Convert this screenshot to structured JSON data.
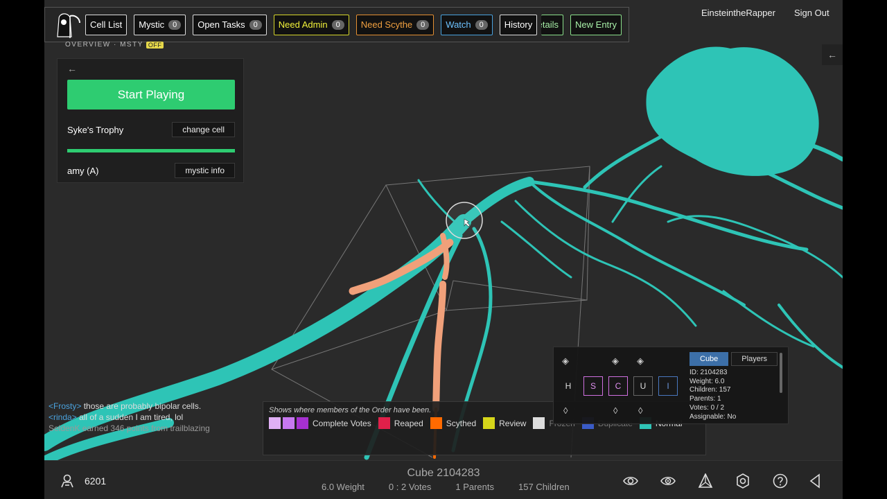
{
  "nav": {
    "buttons": [
      {
        "label": "Cell List"
      },
      {
        "label": "Mystic",
        "count": "0"
      },
      {
        "label": "Open Tasks",
        "count": "0"
      },
      {
        "label": "Need Admin",
        "count": "0"
      },
      {
        "label": "Need Scythe",
        "count": "0"
      },
      {
        "label": "Watch",
        "count": "0"
      },
      {
        "label": "History"
      },
      {
        "label": "be Details"
      },
      {
        "label": "New Entry"
      }
    ],
    "username": "EinsteintheRapper",
    "signout": "Sign Out"
  },
  "overview": {
    "label": "OVERVIEW · MSTY",
    "toggle": "OFF"
  },
  "panel": {
    "back": "←",
    "start": "Start Playing",
    "cell_name": "Syke's Trophy",
    "change_cell": "change cell",
    "player": "amy (A)",
    "mystic_info": "mystic info",
    "progress": 1.0
  },
  "chat": [
    {
      "nick": "Frosty",
      "text": "those are probably bipolar cells."
    },
    {
      "nick": "rinda",
      "text": "all of a sudden I am tired, lol"
    },
    {
      "system": "SeldenK earned 346 points from trailblazing"
    }
  ],
  "legend": {
    "title": "Shows where members of the Order have been.",
    "items": [
      {
        "label": "Complete Votes",
        "color": "#c778f0"
      },
      {
        "label": "Reaped",
        "color": "#e0204a"
      },
      {
        "label": "Scythed",
        "color": "#ff6a00"
      },
      {
        "label": "Review",
        "color": "#d6d61a"
      },
      {
        "label": "Frozen",
        "color": "#dddddd"
      },
      {
        "label": "Duplicate",
        "color": "#3a5bc7"
      },
      {
        "label": "Normal",
        "color": "#2ec4b6"
      }
    ]
  },
  "cube_panel": {
    "tabs": [
      "Cube",
      "Players"
    ],
    "buttons": [
      "H",
      "S",
      "C",
      "U",
      "I"
    ],
    "info": [
      "ID: 2104283",
      "Weight: 6.0",
      "Children: 157",
      "Parents: 1",
      "Votes: 0 / 2",
      "Assignable: No"
    ]
  },
  "bottom": {
    "score": "6201",
    "cube_title": "Cube 2104283",
    "weight": "6.0 Weight",
    "votes": "0 : 2 Votes",
    "parents": "1 Parents",
    "children": "157 Children"
  },
  "right_arrow": "←"
}
